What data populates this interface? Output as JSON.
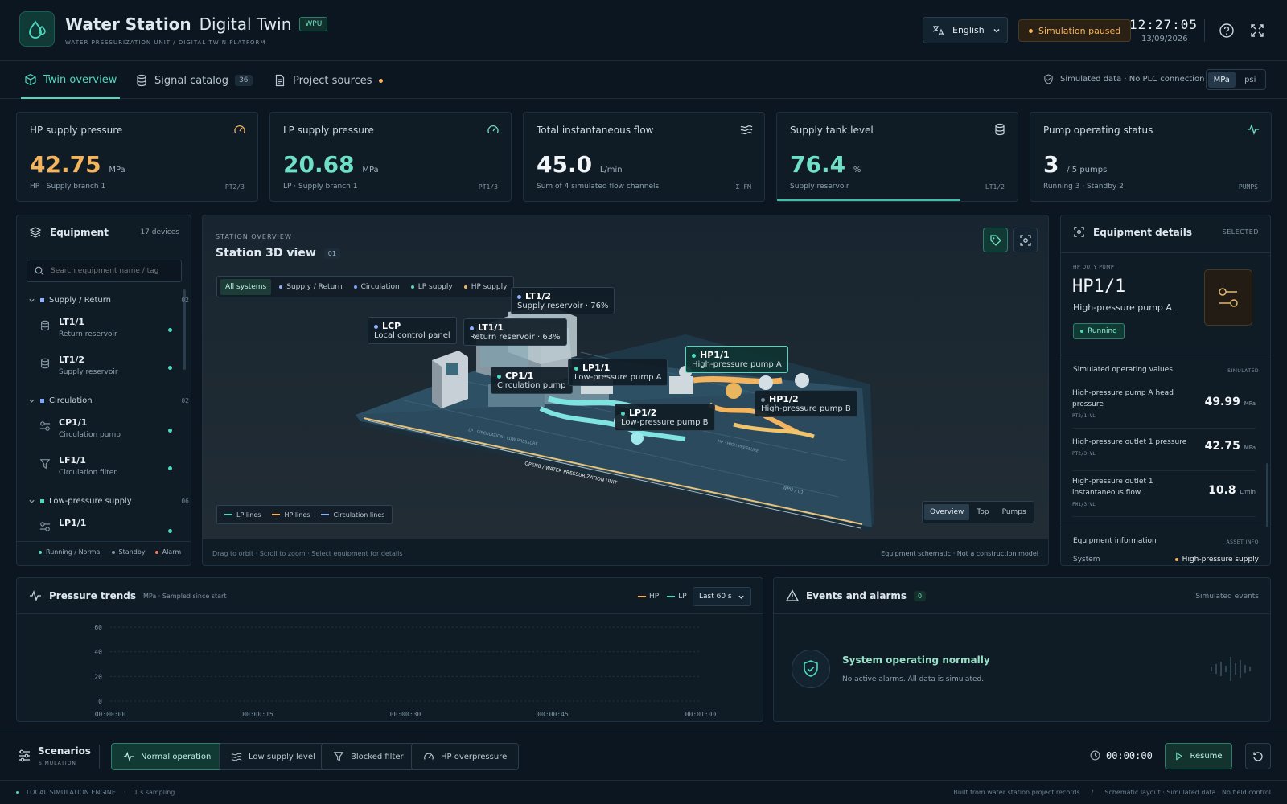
{
  "header": {
    "title_strong": "Water Station",
    "title_light": "Digital Twin",
    "badge": "WPU",
    "subtitle": "WATER PRESSURIZATION UNIT / DIGITAL TWIN PLATFORM",
    "language": "English",
    "sim_status": "Simulation paused",
    "time": "12:27:05",
    "date": "13/09/2026"
  },
  "tabs": [
    {
      "label": "Twin overview"
    },
    {
      "label": "Signal catalog",
      "count": "36"
    },
    {
      "label": "Project sources"
    }
  ],
  "data_notice": "Simulated data · No PLC connection",
  "units": [
    "MPa",
    "psi"
  ],
  "kpis": [
    {
      "title": "HP supply pressure",
      "value": "42.75",
      "unit": "MPa",
      "sub": "HP · Supply branch 1",
      "tag": "PT2/3",
      "icon": "gauge-icon",
      "color": "#f4b45e"
    },
    {
      "title": "LP supply pressure",
      "value": "20.68",
      "unit": "MPa",
      "sub": "LP · Supply branch 1",
      "tag": "PT1/3",
      "icon": "gauge-icon",
      "color": "#6fe0c6"
    },
    {
      "title": "Total instantaneous flow",
      "value": "45.0",
      "unit": "L/min",
      "sub": "Sum of 4 simulated flow channels",
      "tag": "Σ FM",
      "icon": "waves-icon",
      "color": "#f2f5f7"
    },
    {
      "title": "Supply tank level",
      "value": "76.4",
      "unit": "%",
      "sub": "Supply reservoir",
      "tag": "LT1/2",
      "icon": "database-icon",
      "color": "#6fe0c6",
      "level": 0.764
    },
    {
      "title": "Pump operating status",
      "value": "3",
      "unit": "/ 5 pumps",
      "sub": "Running 3 · Standby 2",
      "tag": "PUMPS",
      "icon": "pulse-icon",
      "color": "#f2f5f7"
    }
  ],
  "equipment": {
    "title": "Equipment",
    "count": "17 devices",
    "search_placeholder": "Search equipment name / tag",
    "groups": [
      {
        "name": "Supply / Return",
        "count": "02",
        "color": "#8fb0ff"
      },
      {
        "name": "Circulation",
        "count": "02",
        "color": "#7aa4ff"
      },
      {
        "name": "Low-pressure supply",
        "count": "06",
        "color": "#4fd8c0"
      }
    ],
    "items": [
      {
        "name": "LT1/1",
        "desc": "Return reservoir",
        "icon": "tank-icon"
      },
      {
        "name": "LT1/2",
        "desc": "Supply reservoir",
        "icon": "tank-icon"
      },
      {
        "name": "CP1/1",
        "desc": "Circulation pump",
        "icon": "pump-icon"
      },
      {
        "name": "LF1/1",
        "desc": "Circulation filter",
        "icon": "filter-icon"
      },
      {
        "name": "LP1/1",
        "desc": "",
        "icon": "pump-icon"
      }
    ],
    "legend": [
      "Running / Normal",
      "Standby",
      "Alarm"
    ]
  },
  "viewer": {
    "kicker": "STATION OVERVIEW",
    "title": "Station 3D view",
    "index": "01",
    "filters": [
      "All systems",
      "Supply / Return",
      "Circulation",
      "LP supply",
      "HP supply"
    ],
    "labels": [
      {
        "tag": "LT1/2",
        "desc": "Supply reservoir · 76%"
      },
      {
        "tag": "LCP",
        "desc": "Local control panel"
      },
      {
        "tag": "LT1/1",
        "desc": "Return reservoir · 63%"
      },
      {
        "tag": "CP1/1",
        "desc": "Circulation pump"
      },
      {
        "tag": "LP1/1",
        "desc": "Low-pressure pump A"
      },
      {
        "tag": "HP1/1",
        "desc": "High-pressure pump A"
      },
      {
        "tag": "LP1/2",
        "desc": "Low-pressure pump B"
      },
      {
        "tag": "HP1/2",
        "desc": "High-pressure pump B"
      }
    ],
    "legend": [
      "LP lines",
      "HP lines",
      "Circulation lines"
    ],
    "views": [
      "Overview",
      "Top",
      "Pumps"
    ],
    "hint": "Drag to orbit · Scroll to zoom · Select equipment for details",
    "note": "Equipment schematic · Not a construction model",
    "floor_text": [
      "OPEN8 / WATER PRESSURIZATION UNIT",
      "LP · CIRCULATION · LOW PRESSURE",
      "HP · HIGH PRESSURE",
      "WPU / 01"
    ]
  },
  "details": {
    "title": "Equipment details",
    "selected": "SELECTED",
    "kicker": "HP DUTY PUMP",
    "tag": "HP1/1",
    "name": "High-pressure pump A",
    "status": "Running",
    "sim_title": "Simulated operating values",
    "sim_tag": "SIMULATED",
    "values": [
      {
        "label": "High-pressure pump A head pressure",
        "tag": "PT2/1·VL",
        "value": "49.99",
        "unit": "MPa"
      },
      {
        "label": "High-pressure outlet 1 pressure",
        "tag": "PT2/3·VL",
        "value": "42.75",
        "unit": "MPa"
      },
      {
        "label": "High-pressure outlet 1 instantaneous flow",
        "tag": "FM1/3·VL",
        "value": "10.8",
        "unit": "L/min"
      }
    ],
    "info_title": "Equipment information",
    "info_tag": "ASSET INFO",
    "info_key": "System",
    "info_val": "High-pressure supply"
  },
  "trends": {
    "title": "Pressure trends",
    "sub": "MPa · Sampled since start",
    "series": [
      "HP",
      "LP"
    ],
    "range": "Last 60 s",
    "yticks": [
      "60",
      "40",
      "20",
      "0"
    ],
    "xticks": [
      "00:00:00",
      "00:00:15",
      "00:00:30",
      "00:00:45",
      "00:01:00"
    ]
  },
  "chart_data": {
    "type": "line",
    "title": "Pressure trends",
    "ylabel": "MPa",
    "ylim": [
      0,
      60
    ],
    "x": [
      "00:00:00",
      "00:00:15",
      "00:00:30",
      "00:00:45",
      "00:01:00"
    ],
    "series": [
      {
        "name": "HP",
        "values": []
      },
      {
        "name": "LP",
        "values": []
      }
    ],
    "grid": true,
    "legend": "top-right"
  },
  "events": {
    "title": "Events and alarms",
    "count": "0",
    "tag": "Simulated events",
    "ok_title": "System operating normally",
    "ok_sub": "No active alarms. All data is simulated."
  },
  "scenarios": {
    "title": "Scenarios",
    "sub": "SIMULATION",
    "buttons": [
      "Normal operation",
      "Low supply level",
      "Blocked filter",
      "HP overpressure"
    ],
    "timer": "00:00:00",
    "resume": "Resume"
  },
  "footer": {
    "engine": "LOCAL SIMULATION ENGINE",
    "sampling": "1 s sampling",
    "right1": "Built from water station project records",
    "right2": "Schematic layout · Simulated data · No field control"
  }
}
